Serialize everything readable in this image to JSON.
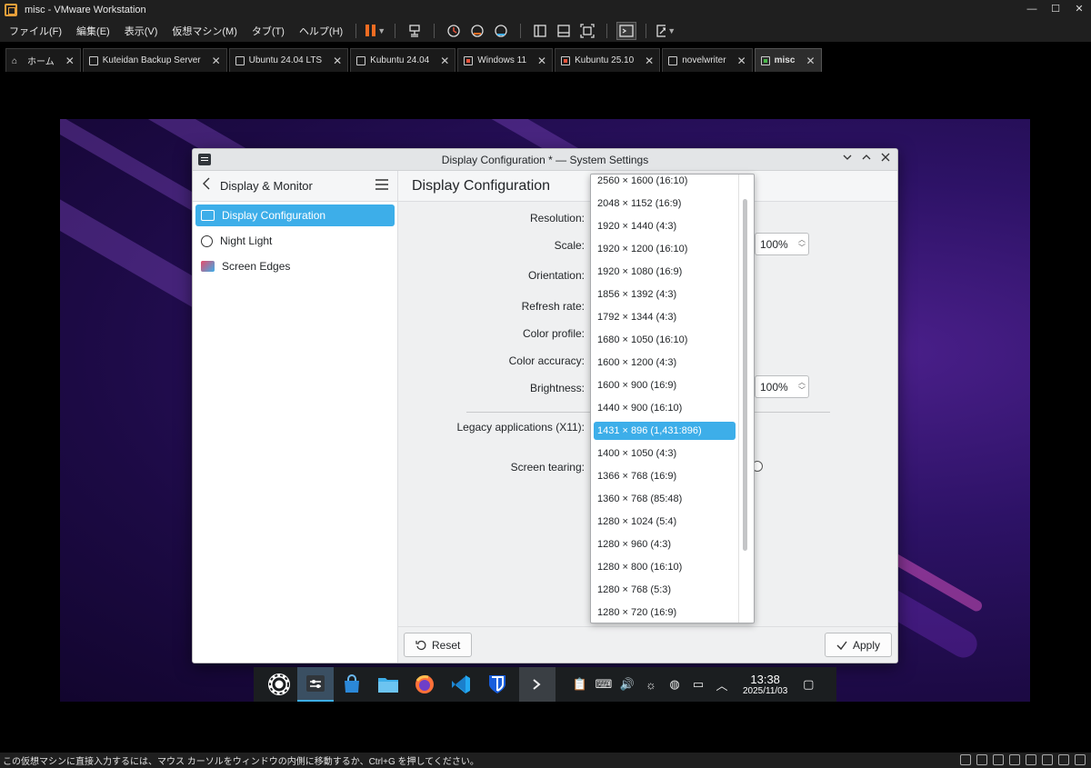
{
  "vmware": {
    "title": "misc - VMware Workstation",
    "window_controls": [
      "—",
      "☐",
      "✕"
    ],
    "menu": [
      "ファイル(F)",
      "編集(E)",
      "表示(V)",
      "仮想マシン(M)",
      "タブ(T)",
      "ヘルプ(H)"
    ],
    "tabs": [
      {
        "label": "ホーム",
        "icon": "home-icon"
      },
      {
        "label": "Kuteidan Backup Server",
        "icon": "vm-icon"
      },
      {
        "label": "Ubuntu 24.04 LTS",
        "icon": "vm-icon"
      },
      {
        "label": "Kubuntu 24.04",
        "icon": "vm-icon"
      },
      {
        "label": "Windows 11",
        "icon": "vm-icon"
      },
      {
        "label": "Kubuntu 25.10",
        "icon": "vm-icon"
      },
      {
        "label": "novelwriter",
        "icon": "vm-icon"
      },
      {
        "label": "misc",
        "icon": "vm-running-icon"
      }
    ],
    "status_text": "この仮想マシンに直接入力するには、マウス カーソルをウィンドウの内側に移動するか、Ctrl+G を押してください。"
  },
  "kde": {
    "window_title": "Display Configuration * — System Settings",
    "header_left": "Display & Monitor",
    "page_title": "Display Configuration",
    "sidebar": [
      {
        "label": "Display Configuration",
        "selected": true
      },
      {
        "label": "Night Light",
        "selected": false
      },
      {
        "label": "Screen Edges",
        "selected": false
      }
    ],
    "form": {
      "resolution_label": "Resolution:",
      "scale_label": "Scale:",
      "scale_value": "100%",
      "orientation_label": "Orientation:",
      "refresh_label": "Refresh rate:",
      "color_profile_label": "Color profile:",
      "color_accuracy_label": "Color accuracy:",
      "brightness_label": "Brightness:",
      "brightness_value": "100%",
      "legacy_label": "Legacy applications (X11):",
      "tearing_label": "Screen tearing:"
    },
    "footer": {
      "reset": "Reset",
      "apply": "Apply"
    },
    "resolution_dropdown": {
      "options": [
        "2560 × 1600 (16:10)",
        "2048 × 1152 (16:9)",
        "1920 × 1440 (4:3)",
        "1920 × 1200 (16:10)",
        "1920 × 1080 (16:9)",
        "1856 × 1392 (4:3)",
        "1792 × 1344 (4:3)",
        "1680 × 1050 (16:10)",
        "1600 × 1200 (4:3)",
        "1600 × 900 (16:9)",
        "1440 × 900 (16:10)",
        "1431 × 896 (1,431:896)",
        "1400 × 1050 (4:3)",
        "1366 × 768 (16:9)",
        "1360 × 768 (85:48)",
        "1280 × 1024 (5:4)",
        "1280 × 960 (4:3)",
        "1280 × 800 (16:10)",
        "1280 × 768 (5:3)",
        "1280 × 720 (16:9)"
      ],
      "selected": "1431 × 896 (1,431:896)"
    }
  },
  "taskbar": {
    "time": "13:38",
    "date": "2025/11/03"
  },
  "colors": {
    "accent": "#3daee9",
    "vmware_orange": "#f06c22"
  }
}
